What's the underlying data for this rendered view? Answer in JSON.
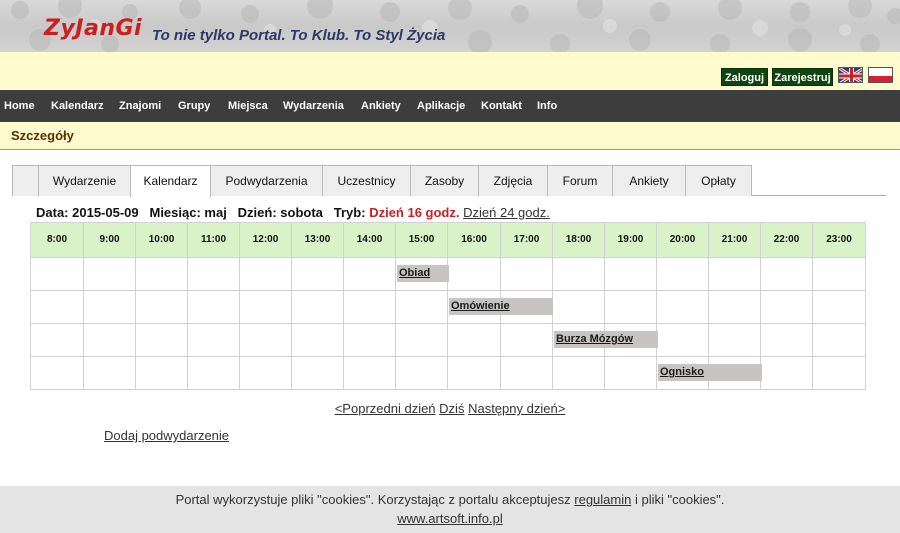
{
  "header": {
    "logo": "ZyJanGi",
    "slogan": "To nie tylko Portal. To Klub. To Styl Życia"
  },
  "topbar": {
    "login_label": "Zaloguj",
    "register_label": "Zarejestruj",
    "flags": [
      "uk-flag-icon",
      "pl-flag-icon"
    ]
  },
  "nav": {
    "items": [
      {
        "label": "Home"
      },
      {
        "label": "Kalendarz"
      },
      {
        "label": "Znajomi"
      },
      {
        "label": "Grupy"
      },
      {
        "label": "Miejsca"
      },
      {
        "label": "Wydarzenia"
      },
      {
        "label": "Ankiety"
      },
      {
        "label": "Aplikacje"
      },
      {
        "label": "Kontakt"
      },
      {
        "label": "Info"
      }
    ]
  },
  "page": {
    "title": "Szczegóły"
  },
  "tabs": {
    "items": [
      {
        "label": ""
      },
      {
        "label": "Wydarzenie"
      },
      {
        "label": "Kalendarz",
        "active": true
      },
      {
        "label": "Podwydarzenia"
      },
      {
        "label": "Uczestnicy"
      },
      {
        "label": "Zasoby"
      },
      {
        "label": "Zdjęcia"
      },
      {
        "label": "Forum"
      },
      {
        "label": "Ankiety"
      },
      {
        "label": "Opłaty"
      }
    ]
  },
  "info": {
    "date_label": "Data:",
    "date_value": "2015-05-09",
    "month_label": "Miesiąc:",
    "month_value": "maj",
    "day_label": "Dzień:",
    "day_value": "sobota",
    "mode_label": "Tryb:",
    "mode_selected": "Dzień 16 godz.",
    "mode_other": "Dzień 24 godz."
  },
  "calendar": {
    "hours": [
      "8:00",
      "9:00",
      "10:00",
      "11:00",
      "12:00",
      "13:00",
      "14:00",
      "15:00",
      "16:00",
      "17:00",
      "18:00",
      "19:00",
      "20:00",
      "21:00",
      "22:00",
      "23:00"
    ],
    "events": [
      {
        "name": "Obiad",
        "start": 15,
        "end": 16,
        "row": 0
      },
      {
        "name": "Omówienie",
        "start": 16,
        "end": 18,
        "row": 1
      },
      {
        "name": "Burza Mózgów",
        "start": 18,
        "end": 20,
        "row": 2
      },
      {
        "name": "Ognisko",
        "start": 20,
        "end": 22,
        "row": 3
      }
    ]
  },
  "daynav": {
    "prev": "<Poprzedni dzień",
    "today": "Dziś",
    "next": "Następny dzień>"
  },
  "actions": {
    "add_sub": "Dodaj podwydarzenie"
  },
  "footer": {
    "cookies_before": "Portal wykorzystuje pliki \"cookies\". Korzystając z portalu akceptujesz",
    "cookies_link": "regulamin",
    "cookies_after": "i pliki \"cookies\".",
    "site": "www.artsoft.info.pl"
  },
  "colors": {
    "logo": "#cc1f1f",
    "nav_bg": "#3d3d3d",
    "topbar_bg": "#fffbcf",
    "button_bg": "#104410",
    "header_cell": "#d9f2c8",
    "event_bg": "#c9c4c4"
  }
}
